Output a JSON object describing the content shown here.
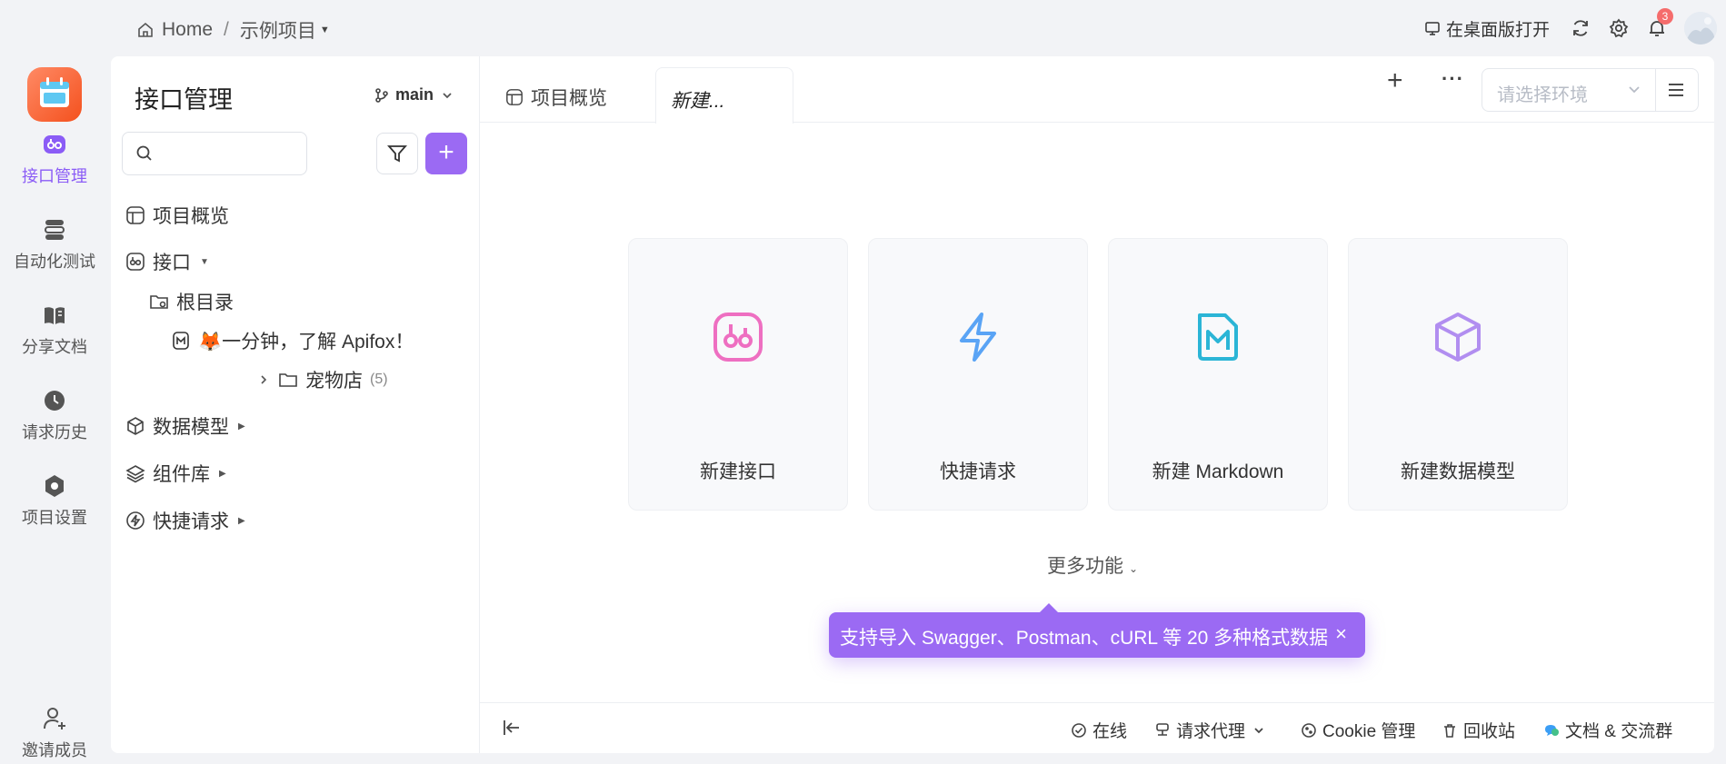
{
  "topbar": {
    "breadcrumb_home": "Home",
    "breadcrumb_sep": "/",
    "breadcrumb_project": "示例项目",
    "open_desktop": "在桌面版打开",
    "notification_count": "3"
  },
  "rail": {
    "items": [
      {
        "label": "接口管理",
        "icon": "api-icon",
        "active": true
      },
      {
        "label": "自动化测试",
        "icon": "automation-icon"
      },
      {
        "label": "分享文档",
        "icon": "book-icon"
      },
      {
        "label": "请求历史",
        "icon": "clock-icon"
      },
      {
        "label": "项目设置",
        "icon": "settings-icon"
      },
      {
        "label": "邀请成员",
        "icon": "add-user-icon"
      }
    ]
  },
  "sidebar": {
    "title": "接口管理",
    "branch": "main",
    "tree": {
      "overview": "项目概览",
      "api": "接口",
      "root": "根目录",
      "doc_item": "🦊一分钟，了解 Apifox！",
      "petstore": "宠物店",
      "petstore_count": "(5)",
      "models": "数据模型",
      "components": "组件库",
      "quick": "快捷请求"
    }
  },
  "tabs": {
    "overview": "项目概览",
    "new": "新建..."
  },
  "env": {
    "placeholder": "请选择环境"
  },
  "cards": [
    {
      "label": "新建接口",
      "icon": "api-icon",
      "color": "#ee6fc1"
    },
    {
      "label": "快捷请求",
      "icon": "lightning-icon",
      "color": "#5aa4f5"
    },
    {
      "label": "新建 Markdown",
      "icon": "markdown-icon",
      "color": "#2bb5d6"
    },
    {
      "label": "新建数据模型",
      "icon": "cube-icon",
      "color": "#b18ef0"
    }
  ],
  "more_features": "更多功能",
  "tooltip": {
    "text": "支持导入 Swagger、Postman、cURL 等 20 多种格式数据",
    "close": "×"
  },
  "statusbar": {
    "online": "在线",
    "proxy": "请求代理",
    "cookie": "Cookie 管理",
    "trash": "回收站",
    "docs": "文档 & 交流群"
  },
  "colors": {
    "accent": "#9b6af3",
    "background": "#f2f3f6"
  }
}
